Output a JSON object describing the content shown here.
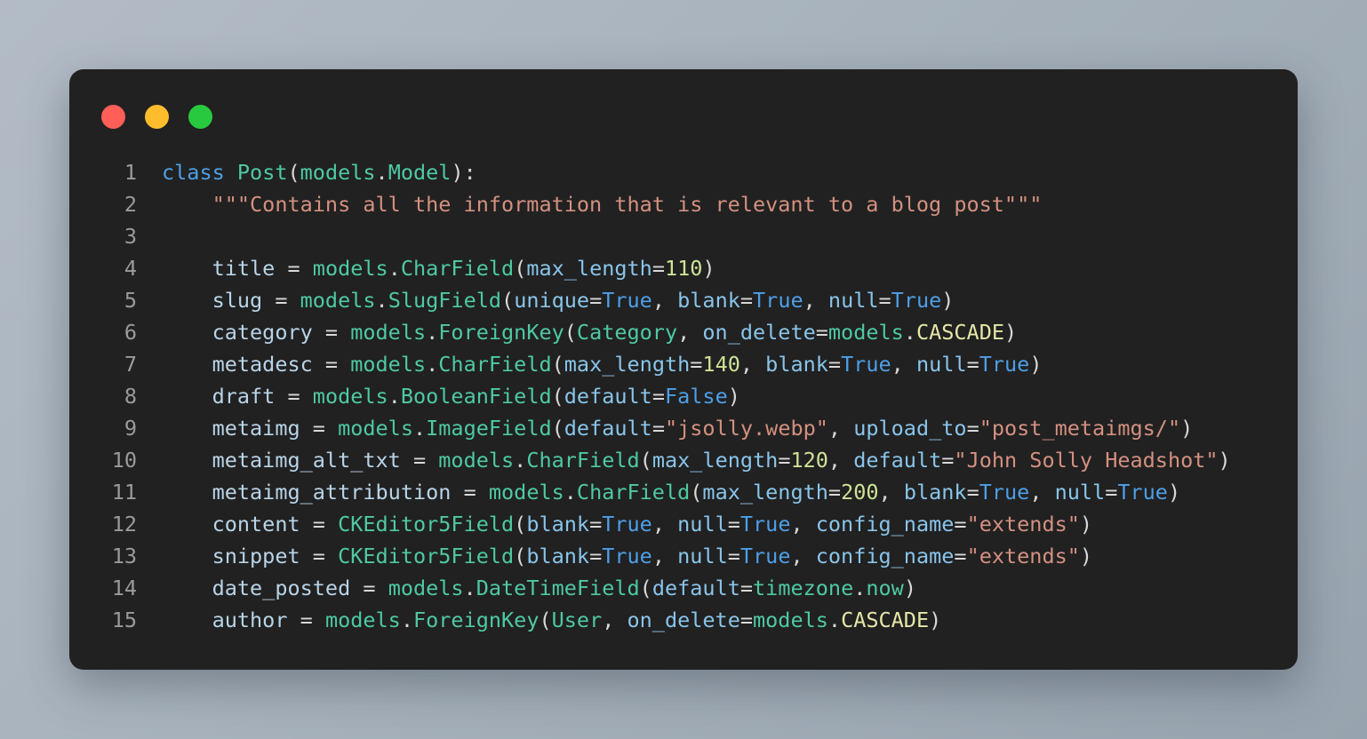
{
  "window": {
    "controls": [
      {
        "name": "close",
        "color": "#ff5f57"
      },
      {
        "name": "minimize",
        "color": "#ffbd2e"
      },
      {
        "name": "maximize",
        "color": "#28c93f"
      }
    ],
    "background_color": "#212121",
    "page_background": "#a8b3bd"
  },
  "editor": {
    "language": "python",
    "line_numbers": [
      "1",
      "2",
      "3",
      "4",
      "5",
      "6",
      "7",
      "8",
      "9",
      "10",
      "11",
      "12",
      "13",
      "14",
      "15"
    ],
    "lines": [
      {
        "number": "1",
        "text": "class Post(models.Model):",
        "tokens": [
          {
            "t": "class",
            "c": "t-kw"
          },
          {
            "t": " ",
            "c": "t-punc"
          },
          {
            "t": "Post",
            "c": "t-cls"
          },
          {
            "t": "(",
            "c": "t-punc"
          },
          {
            "t": "models",
            "c": "t-mod"
          },
          {
            "t": ".",
            "c": "t-punc"
          },
          {
            "t": "Model",
            "c": "t-attr"
          },
          {
            "t": "):",
            "c": "t-punc"
          }
        ]
      },
      {
        "number": "2",
        "text": "    \"\"\"Contains all the information that is relevant to a blog post\"\"\"",
        "tokens": [
          {
            "t": "    ",
            "c": "t-punc"
          },
          {
            "t": "\"\"\"Contains all the information that is relevant to a blog post\"\"\"",
            "c": "t-doc"
          }
        ]
      },
      {
        "number": "3",
        "text": "",
        "tokens": []
      },
      {
        "number": "4",
        "text": "    title = models.CharField(max_length=110)",
        "tokens": [
          {
            "t": "    ",
            "c": "t-punc"
          },
          {
            "t": "title",
            "c": "t-var"
          },
          {
            "t": " = ",
            "c": "t-punc"
          },
          {
            "t": "models",
            "c": "t-mod"
          },
          {
            "t": ".",
            "c": "t-punc"
          },
          {
            "t": "CharField",
            "c": "t-attr"
          },
          {
            "t": "(",
            "c": "t-punc"
          },
          {
            "t": "max_length",
            "c": "t-param"
          },
          {
            "t": "=",
            "c": "t-punc"
          },
          {
            "t": "110",
            "c": "t-num"
          },
          {
            "t": ")",
            "c": "t-punc"
          }
        ]
      },
      {
        "number": "5",
        "text": "    slug = models.SlugField(unique=True, blank=True, null=True)",
        "tokens": [
          {
            "t": "    ",
            "c": "t-punc"
          },
          {
            "t": "slug",
            "c": "t-var"
          },
          {
            "t": " = ",
            "c": "t-punc"
          },
          {
            "t": "models",
            "c": "t-mod"
          },
          {
            "t": ".",
            "c": "t-punc"
          },
          {
            "t": "SlugField",
            "c": "t-attr"
          },
          {
            "t": "(",
            "c": "t-punc"
          },
          {
            "t": "unique",
            "c": "t-param"
          },
          {
            "t": "=",
            "c": "t-punc"
          },
          {
            "t": "True",
            "c": "t-kw"
          },
          {
            "t": ", ",
            "c": "t-punc"
          },
          {
            "t": "blank",
            "c": "t-param"
          },
          {
            "t": "=",
            "c": "t-punc"
          },
          {
            "t": "True",
            "c": "t-kw"
          },
          {
            "t": ", ",
            "c": "t-punc"
          },
          {
            "t": "null",
            "c": "t-param"
          },
          {
            "t": "=",
            "c": "t-punc"
          },
          {
            "t": "True",
            "c": "t-kw"
          },
          {
            "t": ")",
            "c": "t-punc"
          }
        ]
      },
      {
        "number": "6",
        "text": "    category = models.ForeignKey(Category, on_delete=models.CASCADE)",
        "tokens": [
          {
            "t": "    ",
            "c": "t-punc"
          },
          {
            "t": "category",
            "c": "t-var"
          },
          {
            "t": " = ",
            "c": "t-punc"
          },
          {
            "t": "models",
            "c": "t-mod"
          },
          {
            "t": ".",
            "c": "t-punc"
          },
          {
            "t": "ForeignKey",
            "c": "t-attr"
          },
          {
            "t": "(",
            "c": "t-punc"
          },
          {
            "t": "Category",
            "c": "t-cls"
          },
          {
            "t": ", ",
            "c": "t-punc"
          },
          {
            "t": "on_delete",
            "c": "t-param"
          },
          {
            "t": "=",
            "c": "t-punc"
          },
          {
            "t": "models",
            "c": "t-mod"
          },
          {
            "t": ".",
            "c": "t-punc"
          },
          {
            "t": "CASCADE",
            "c": "t-const"
          },
          {
            "t": ")",
            "c": "t-punc"
          }
        ]
      },
      {
        "number": "7",
        "text": "    metadesc = models.CharField(max_length=140, blank=True, null=True)",
        "tokens": [
          {
            "t": "    ",
            "c": "t-punc"
          },
          {
            "t": "metadesc",
            "c": "t-var"
          },
          {
            "t": " = ",
            "c": "t-punc"
          },
          {
            "t": "models",
            "c": "t-mod"
          },
          {
            "t": ".",
            "c": "t-punc"
          },
          {
            "t": "CharField",
            "c": "t-attr"
          },
          {
            "t": "(",
            "c": "t-punc"
          },
          {
            "t": "max_length",
            "c": "t-param"
          },
          {
            "t": "=",
            "c": "t-punc"
          },
          {
            "t": "140",
            "c": "t-num"
          },
          {
            "t": ", ",
            "c": "t-punc"
          },
          {
            "t": "blank",
            "c": "t-param"
          },
          {
            "t": "=",
            "c": "t-punc"
          },
          {
            "t": "True",
            "c": "t-kw"
          },
          {
            "t": ", ",
            "c": "t-punc"
          },
          {
            "t": "null",
            "c": "t-param"
          },
          {
            "t": "=",
            "c": "t-punc"
          },
          {
            "t": "True",
            "c": "t-kw"
          },
          {
            "t": ")",
            "c": "t-punc"
          }
        ]
      },
      {
        "number": "8",
        "text": "    draft = models.BooleanField(default=False)",
        "tokens": [
          {
            "t": "    ",
            "c": "t-punc"
          },
          {
            "t": "draft",
            "c": "t-var"
          },
          {
            "t": " = ",
            "c": "t-punc"
          },
          {
            "t": "models",
            "c": "t-mod"
          },
          {
            "t": ".",
            "c": "t-punc"
          },
          {
            "t": "BooleanField",
            "c": "t-attr"
          },
          {
            "t": "(",
            "c": "t-punc"
          },
          {
            "t": "default",
            "c": "t-param"
          },
          {
            "t": "=",
            "c": "t-punc"
          },
          {
            "t": "False",
            "c": "t-kw"
          },
          {
            "t": ")",
            "c": "t-punc"
          }
        ]
      },
      {
        "number": "9",
        "text": "    metaimg = models.ImageField(default=\"jsolly.webp\", upload_to=\"post_metaimgs/\")",
        "tokens": [
          {
            "t": "    ",
            "c": "t-punc"
          },
          {
            "t": "metaimg",
            "c": "t-var"
          },
          {
            "t": " = ",
            "c": "t-punc"
          },
          {
            "t": "models",
            "c": "t-mod"
          },
          {
            "t": ".",
            "c": "t-punc"
          },
          {
            "t": "ImageField",
            "c": "t-attr"
          },
          {
            "t": "(",
            "c": "t-punc"
          },
          {
            "t": "default",
            "c": "t-param"
          },
          {
            "t": "=",
            "c": "t-punc"
          },
          {
            "t": "\"jsolly.webp\"",
            "c": "t-str"
          },
          {
            "t": ", ",
            "c": "t-punc"
          },
          {
            "t": "upload_to",
            "c": "t-param"
          },
          {
            "t": "=",
            "c": "t-punc"
          },
          {
            "t": "\"post_metaimgs/\"",
            "c": "t-str"
          },
          {
            "t": ")",
            "c": "t-punc"
          }
        ]
      },
      {
        "number": "10",
        "text": "    metaimg_alt_txt = models.CharField(max_length=120, default=\"John Solly Headshot\")",
        "tokens": [
          {
            "t": "    ",
            "c": "t-punc"
          },
          {
            "t": "metaimg_alt_txt",
            "c": "t-var"
          },
          {
            "t": " = ",
            "c": "t-punc"
          },
          {
            "t": "models",
            "c": "t-mod"
          },
          {
            "t": ".",
            "c": "t-punc"
          },
          {
            "t": "CharField",
            "c": "t-attr"
          },
          {
            "t": "(",
            "c": "t-punc"
          },
          {
            "t": "max_length",
            "c": "t-param"
          },
          {
            "t": "=",
            "c": "t-punc"
          },
          {
            "t": "120",
            "c": "t-num"
          },
          {
            "t": ", ",
            "c": "t-punc"
          },
          {
            "t": "default",
            "c": "t-param"
          },
          {
            "t": "=",
            "c": "t-punc"
          },
          {
            "t": "\"John Solly Headshot\"",
            "c": "t-str"
          },
          {
            "t": ")",
            "c": "t-punc"
          }
        ]
      },
      {
        "number": "11",
        "text": "    metaimg_attribution = models.CharField(max_length=200, blank=True, null=True)",
        "tokens": [
          {
            "t": "    ",
            "c": "t-punc"
          },
          {
            "t": "metaimg_attribution",
            "c": "t-var"
          },
          {
            "t": " = ",
            "c": "t-punc"
          },
          {
            "t": "models",
            "c": "t-mod"
          },
          {
            "t": ".",
            "c": "t-punc"
          },
          {
            "t": "CharField",
            "c": "t-attr"
          },
          {
            "t": "(",
            "c": "t-punc"
          },
          {
            "t": "max_length",
            "c": "t-param"
          },
          {
            "t": "=",
            "c": "t-punc"
          },
          {
            "t": "200",
            "c": "t-num"
          },
          {
            "t": ", ",
            "c": "t-punc"
          },
          {
            "t": "blank",
            "c": "t-param"
          },
          {
            "t": "=",
            "c": "t-punc"
          },
          {
            "t": "True",
            "c": "t-kw"
          },
          {
            "t": ", ",
            "c": "t-punc"
          },
          {
            "t": "null",
            "c": "t-param"
          },
          {
            "t": "=",
            "c": "t-punc"
          },
          {
            "t": "True",
            "c": "t-kw"
          },
          {
            "t": ")",
            "c": "t-punc"
          }
        ]
      },
      {
        "number": "12",
        "text": "    content = CKEditor5Field(blank=True, null=True, config_name=\"extends\")",
        "tokens": [
          {
            "t": "    ",
            "c": "t-punc"
          },
          {
            "t": "content",
            "c": "t-var"
          },
          {
            "t": " = ",
            "c": "t-punc"
          },
          {
            "t": "CKEditor5Field",
            "c": "t-attr"
          },
          {
            "t": "(",
            "c": "t-punc"
          },
          {
            "t": "blank",
            "c": "t-param"
          },
          {
            "t": "=",
            "c": "t-punc"
          },
          {
            "t": "True",
            "c": "t-kw"
          },
          {
            "t": ", ",
            "c": "t-punc"
          },
          {
            "t": "null",
            "c": "t-param"
          },
          {
            "t": "=",
            "c": "t-punc"
          },
          {
            "t": "True",
            "c": "t-kw"
          },
          {
            "t": ", ",
            "c": "t-punc"
          },
          {
            "t": "config_name",
            "c": "t-param"
          },
          {
            "t": "=",
            "c": "t-punc"
          },
          {
            "t": "\"extends\"",
            "c": "t-str"
          },
          {
            "t": ")",
            "c": "t-punc"
          }
        ]
      },
      {
        "number": "13",
        "text": "    snippet = CKEditor5Field(blank=True, null=True, config_name=\"extends\")",
        "tokens": [
          {
            "t": "    ",
            "c": "t-punc"
          },
          {
            "t": "snippet",
            "c": "t-var"
          },
          {
            "t": " = ",
            "c": "t-punc"
          },
          {
            "t": "CKEditor5Field",
            "c": "t-attr"
          },
          {
            "t": "(",
            "c": "t-punc"
          },
          {
            "t": "blank",
            "c": "t-param"
          },
          {
            "t": "=",
            "c": "t-punc"
          },
          {
            "t": "True",
            "c": "t-kw"
          },
          {
            "t": ", ",
            "c": "t-punc"
          },
          {
            "t": "null",
            "c": "t-param"
          },
          {
            "t": "=",
            "c": "t-punc"
          },
          {
            "t": "True",
            "c": "t-kw"
          },
          {
            "t": ", ",
            "c": "t-punc"
          },
          {
            "t": "config_name",
            "c": "t-param"
          },
          {
            "t": "=",
            "c": "t-punc"
          },
          {
            "t": "\"extends\"",
            "c": "t-str"
          },
          {
            "t": ")",
            "c": "t-punc"
          }
        ]
      },
      {
        "number": "14",
        "text": "    date_posted = models.DateTimeField(default=timezone.now)",
        "tokens": [
          {
            "t": "    ",
            "c": "t-punc"
          },
          {
            "t": "date_posted",
            "c": "t-var"
          },
          {
            "t": " = ",
            "c": "t-punc"
          },
          {
            "t": "models",
            "c": "t-mod"
          },
          {
            "t": ".",
            "c": "t-punc"
          },
          {
            "t": "DateTimeField",
            "c": "t-attr"
          },
          {
            "t": "(",
            "c": "t-punc"
          },
          {
            "t": "default",
            "c": "t-param"
          },
          {
            "t": "=",
            "c": "t-punc"
          },
          {
            "t": "timezone",
            "c": "t-mod"
          },
          {
            "t": ".",
            "c": "t-punc"
          },
          {
            "t": "now",
            "c": "t-attr"
          },
          {
            "t": ")",
            "c": "t-punc"
          }
        ]
      },
      {
        "number": "15",
        "text": "    author = models.ForeignKey(User, on_delete=models.CASCADE)",
        "tokens": [
          {
            "t": "    ",
            "c": "t-punc"
          },
          {
            "t": "author",
            "c": "t-var"
          },
          {
            "t": " = ",
            "c": "t-punc"
          },
          {
            "t": "models",
            "c": "t-mod"
          },
          {
            "t": ".",
            "c": "t-punc"
          },
          {
            "t": "ForeignKey",
            "c": "t-attr"
          },
          {
            "t": "(",
            "c": "t-punc"
          },
          {
            "t": "User",
            "c": "t-cls"
          },
          {
            "t": ", ",
            "c": "t-punc"
          },
          {
            "t": "on_delete",
            "c": "t-param"
          },
          {
            "t": "=",
            "c": "t-punc"
          },
          {
            "t": "models",
            "c": "t-mod"
          },
          {
            "t": ".",
            "c": "t-punc"
          },
          {
            "t": "CASCADE",
            "c": "t-const"
          },
          {
            "t": ")",
            "c": "t-punc"
          }
        ]
      }
    ]
  }
}
